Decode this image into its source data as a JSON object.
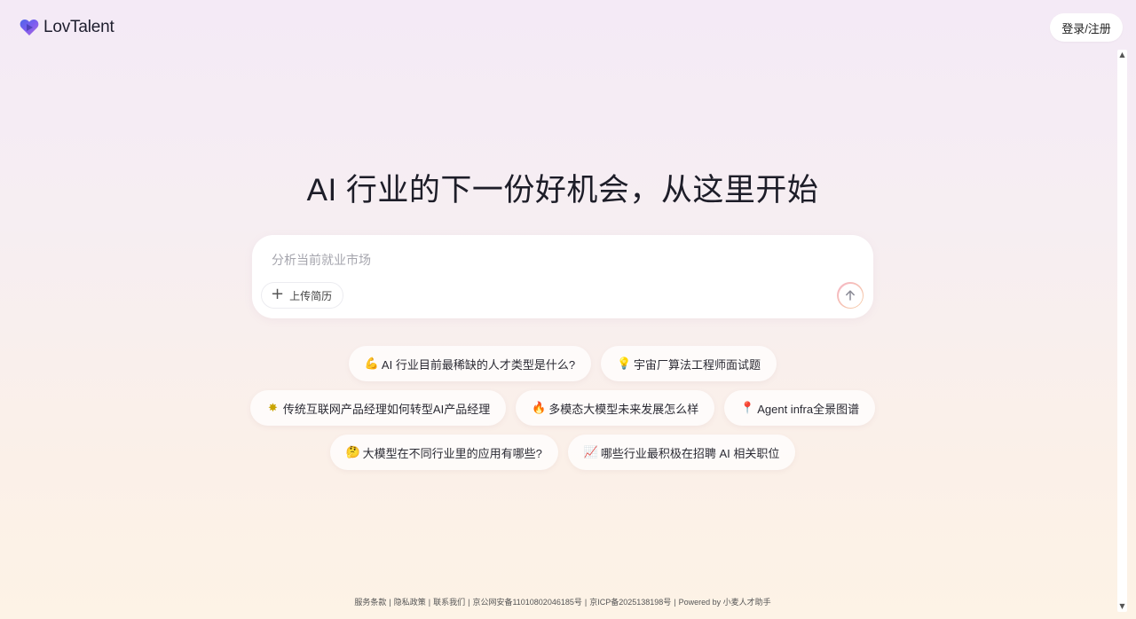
{
  "brand": {
    "name": "LovTalent",
    "logo_colors": [
      "#4e67e8",
      "#7b5cf0",
      "#b06ad9"
    ]
  },
  "header": {
    "login_label": "登录/注册"
  },
  "main": {
    "headline": "AI 行业的下一份好机会，从这里开始",
    "input_placeholder": "分析当前就业市场",
    "upload_label": "上传简历"
  },
  "suggestions": [
    [
      {
        "icon": "flexed-biceps-icon",
        "glyph": "💪",
        "label": "AI 行业目前最稀缺的人才类型是什么?"
      },
      {
        "icon": "light-bulb-icon",
        "glyph": "💡",
        "label": "宇宙厂算法工程师面试题"
      }
    ],
    [
      {
        "icon": "sparkle-burst-icon",
        "glyph": "✸",
        "label": "传统互联网产品经理如何转型AI产品经理"
      },
      {
        "icon": "fire-icon",
        "glyph": "🔥",
        "label": "多模态大模型未来发展怎么样"
      },
      {
        "icon": "pushpin-icon",
        "glyph": "📍",
        "label": "Agent infra全景图谱"
      }
    ],
    [
      {
        "icon": "thinking-face-icon",
        "glyph": "🤔",
        "label": "大模型在不同行业里的应用有哪些?"
      },
      {
        "icon": "chart-increasing-icon",
        "glyph": "📈",
        "label": "哪些行业最积极在招聘 AI 相关职位"
      }
    ]
  ],
  "footer": {
    "links": [
      "服务条款",
      "隐私政策",
      "联系我们",
      "京公网安备11010802046185号",
      "京ICP备2025138198号",
      "Powered by 小麦人才助手"
    ],
    "separator": "|"
  },
  "colors": {
    "accent_gradient_start": "#f6b8c8",
    "accent_gradient_end": "#f5c9a0"
  }
}
